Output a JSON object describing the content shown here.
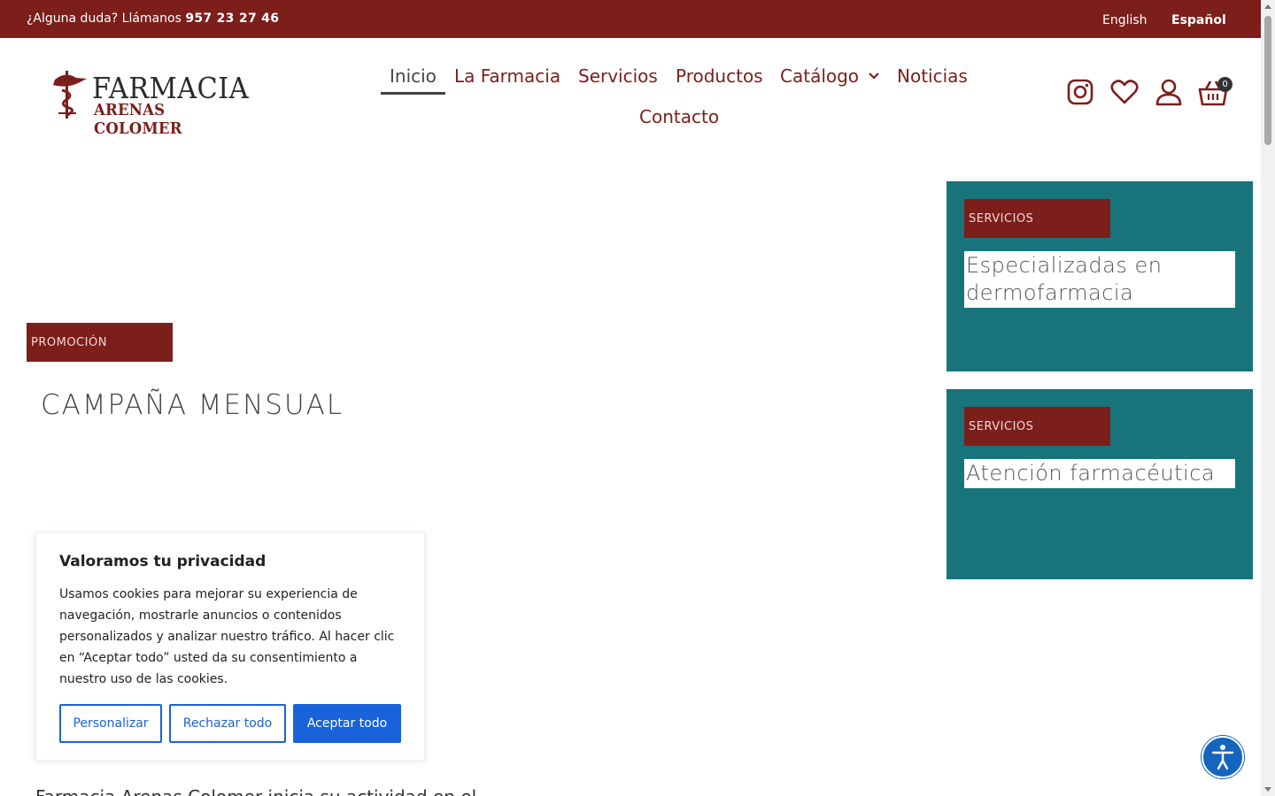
{
  "topbar": {
    "contact_prefix": "¿Alguna duda? Llámanos ",
    "phone": "957 23 27 46",
    "languages": [
      "English",
      "Español"
    ],
    "active_language": "Español"
  },
  "logo": {
    "line1": "FARMACIA",
    "line2": "ARENAS COLOMER"
  },
  "nav": {
    "items": [
      "Inicio",
      "La Farmacia",
      "Servicios",
      "Productos",
      "Catálogo",
      "Noticias",
      "Contacto"
    ],
    "active": "Inicio"
  },
  "header_icons": {
    "instagram": "instagram-icon",
    "wishlist": "heart-icon",
    "account": "user-icon",
    "cart": "basket-icon",
    "cart_count": "0"
  },
  "promo": {
    "badge": "PROMOCIÓN",
    "title": "CAMPAÑA MENSUAL"
  },
  "cards": [
    {
      "badge": "SERVICIOS",
      "title": "Especializadas en dermofarmacia"
    },
    {
      "badge": "SERVICIOS",
      "title": "Atención farmacéutica"
    }
  ],
  "cookie": {
    "title": "Valoramos tu privacidad",
    "body": "Usamos cookies para mejorar su experiencia de navegación, mostrarle anuncios o contenidos personalizados y analizar nuestro tráfico. Al hacer clic en “Aceptar todo” usted da su consentimiento a nuestro uso de las cookies.",
    "buttons": [
      "Personalizar",
      "Rechazar todo",
      "Aceptar todo"
    ]
  },
  "bottom_text": "Farmacia Arenas Colomer inicia su actividad en el",
  "colors": {
    "brand": "#7c1e1a",
    "teal": "#17747b",
    "cookie_blue": "#1863dc",
    "accessibility_blue": "#1565c0"
  }
}
